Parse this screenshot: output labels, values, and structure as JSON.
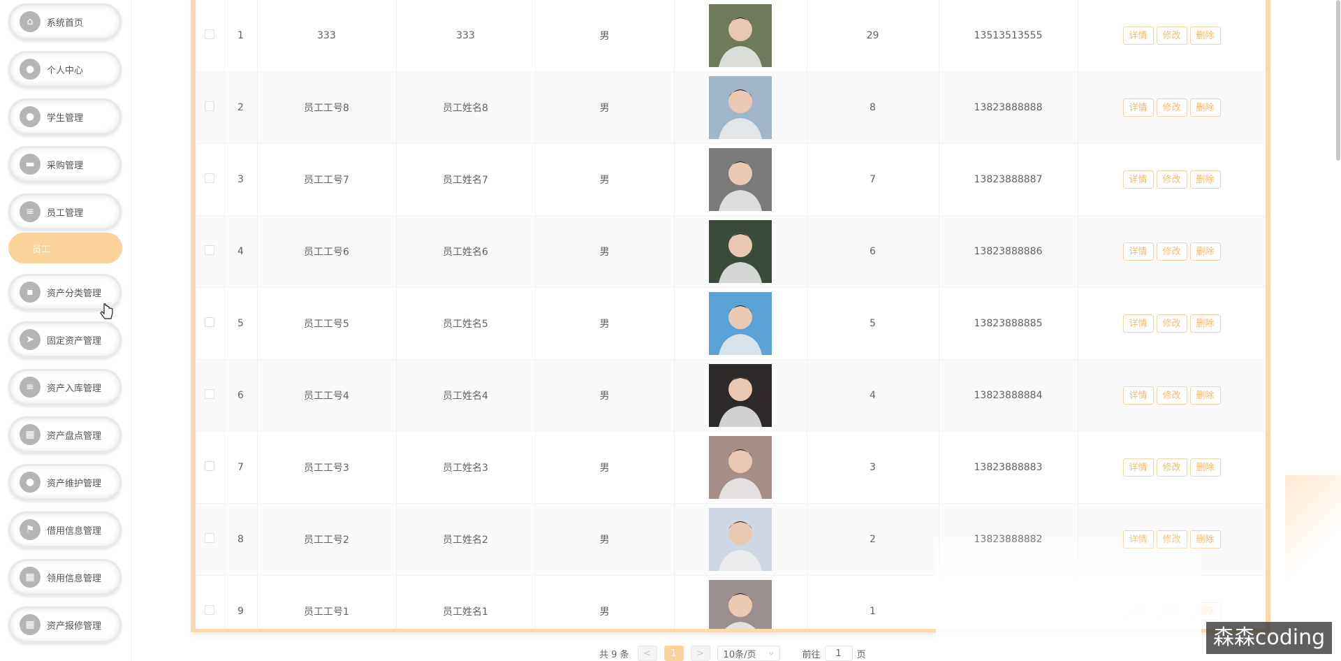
{
  "sidebar": {
    "items": [
      {
        "label": "系统首页",
        "icon": "home-icon",
        "glyph": "⌂"
      },
      {
        "label": "个人中心",
        "icon": "user-icon",
        "glyph": "●"
      },
      {
        "label": "学生管理",
        "icon": "location-icon",
        "glyph": "●"
      },
      {
        "label": "采购管理",
        "icon": "briefcase-icon",
        "glyph": "▬"
      },
      {
        "label": "员工管理",
        "icon": "menu-icon",
        "glyph": "≡"
      },
      {
        "label": "资产分类管理",
        "icon": "chat-icon",
        "glyph": "▪"
      },
      {
        "label": "固定资产管理",
        "icon": "send-icon",
        "glyph": "➤"
      },
      {
        "label": "资产入库管理",
        "icon": "sliders-icon",
        "glyph": "≡"
      },
      {
        "label": "资产盘点管理",
        "icon": "grid-icon",
        "glyph": "▦"
      },
      {
        "label": "资产维护管理",
        "icon": "user-icon",
        "glyph": "●"
      },
      {
        "label": "借用信息管理",
        "icon": "flag-icon",
        "glyph": "⚑"
      },
      {
        "label": "领用信息管理",
        "icon": "apps-icon",
        "glyph": "▦"
      },
      {
        "label": "资产报修管理",
        "icon": "grid-icon",
        "glyph": "▦"
      }
    ],
    "active_sub": "员工"
  },
  "table": {
    "rows": [
      {
        "index": "1",
        "emp_no": "333",
        "name": "333",
        "gender": "男",
        "age": "29",
        "phone": "13513513555"
      },
      {
        "index": "2",
        "emp_no": "员工工号8",
        "name": "员工姓名8",
        "gender": "男",
        "age": "8",
        "phone": "13823888888"
      },
      {
        "index": "3",
        "emp_no": "员工工号7",
        "name": "员工姓名7",
        "gender": "男",
        "age": "7",
        "phone": "13823888887"
      },
      {
        "index": "4",
        "emp_no": "员工工号6",
        "name": "员工姓名6",
        "gender": "男",
        "age": "6",
        "phone": "13823888886"
      },
      {
        "index": "5",
        "emp_no": "员工工号5",
        "name": "员工姓名5",
        "gender": "男",
        "age": "5",
        "phone": "13823888885"
      },
      {
        "index": "6",
        "emp_no": "员工工号4",
        "name": "员工姓名4",
        "gender": "男",
        "age": "4",
        "phone": "13823888884"
      },
      {
        "index": "7",
        "emp_no": "员工工号3",
        "name": "员工姓名3",
        "gender": "男",
        "age": "3",
        "phone": "13823888883"
      },
      {
        "index": "8",
        "emp_no": "员工工号2",
        "name": "员工姓名2",
        "gender": "男",
        "age": "2",
        "phone": "13823888882"
      },
      {
        "index": "9",
        "emp_no": "员工工号1",
        "name": "员工姓名1",
        "gender": "男",
        "age": "1",
        "phone": ""
      }
    ],
    "actions": {
      "detail": "详情",
      "edit": "修改",
      "delete": "删除"
    },
    "avatar_colors": [
      "#6f7a5c",
      "#9fb6c9",
      "#7b7b7b",
      "#3a4b3a",
      "#5aa3d6",
      "#2f2a2a",
      "#a58f88",
      "#cfd6e4",
      "#9b8f8f"
    ]
  },
  "pagination": {
    "total": "共 9 条",
    "prev": "<",
    "current_page": "1",
    "next": ">",
    "page_size": "10条/页",
    "goto_label": "前往",
    "goto_value": "1",
    "page_suffix": "页"
  },
  "watermark": "森森coding",
  "colors": {
    "accent": "#fbd39a",
    "panel_border": "#fbd9ae",
    "button_text": "#f6b96a"
  }
}
